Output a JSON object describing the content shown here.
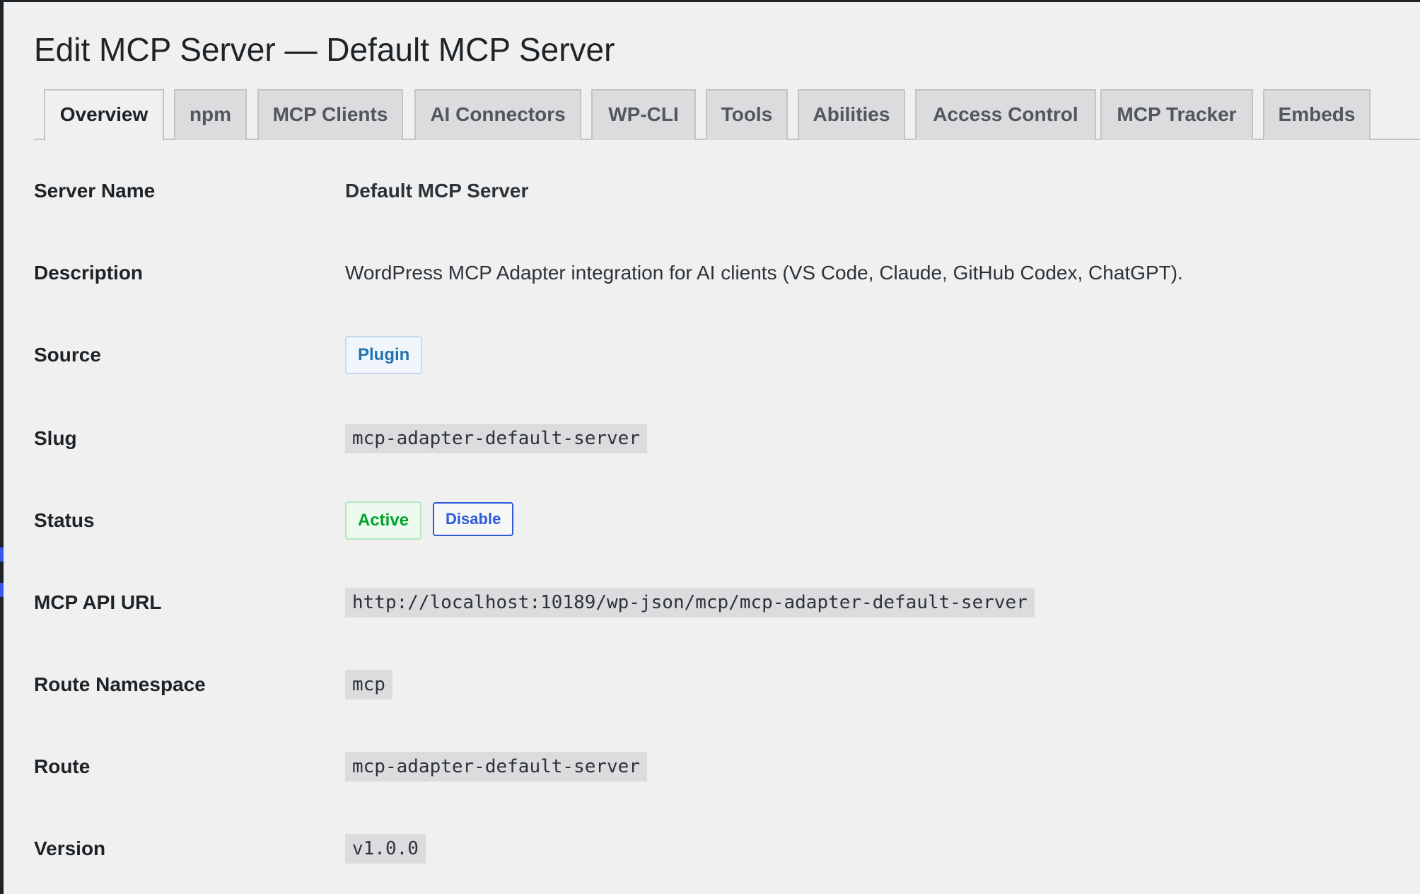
{
  "page": {
    "title": "Edit MCP Server — Default MCP Server"
  },
  "tabs": [
    {
      "label": "Overview",
      "active": true
    },
    {
      "label": "npm",
      "active": false
    },
    {
      "label": "MCP Clients",
      "active": false
    },
    {
      "label": "AI Connectors",
      "active": false
    },
    {
      "label": "WP-CLI",
      "active": false
    },
    {
      "label": "Tools",
      "active": false
    },
    {
      "label": "Abilities",
      "active": false
    },
    {
      "label": "Access Control",
      "active": false
    },
    {
      "label": "MCP Tracker",
      "active": false
    },
    {
      "label": "Embeds",
      "active": false
    }
  ],
  "details": {
    "server_name": {
      "label": "Server Name",
      "value": "Default MCP Server"
    },
    "description": {
      "label": "Description",
      "value": "WordPress MCP Adapter integration for AI clients (VS Code, Claude, GitHub Codex, ChatGPT)."
    },
    "source": {
      "label": "Source",
      "value": "Plugin"
    },
    "slug": {
      "label": "Slug",
      "value": "mcp-adapter-default-server"
    },
    "status": {
      "label": "Status",
      "value": "Active",
      "action_label": "Disable"
    },
    "api_url": {
      "label": "MCP API URL",
      "value": "http://localhost:10189/wp-json/mcp/mcp-adapter-default-server"
    },
    "route_namespace": {
      "label": "Route Namespace",
      "value": "mcp"
    },
    "route": {
      "label": "Route",
      "value": "mcp-adapter-default-server"
    },
    "version": {
      "label": "Version",
      "value": "v1.0.0"
    }
  },
  "colors": {
    "background": "#f0f0f1",
    "link": "#2271b1",
    "success": "#00a32a",
    "accent": "#3858e9"
  }
}
